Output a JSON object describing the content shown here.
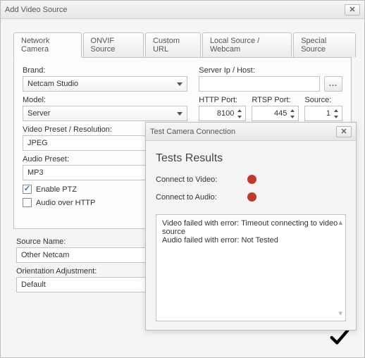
{
  "dialog": {
    "title": "Add Video Source",
    "tabs": [
      {
        "label": "Network Camera"
      },
      {
        "label": "ONVIF Source"
      },
      {
        "label": "Custom URL"
      },
      {
        "label": "Local Source / Webcam"
      },
      {
        "label": "Special Source"
      }
    ],
    "active_tab_index": 0
  },
  "form": {
    "brand_label": "Brand:",
    "brand_value": "Netcam Studio",
    "server_label": "Server Ip / Host:",
    "server_value": "",
    "browse_label": "...",
    "model_label": "Model:",
    "model_value": "Server",
    "http_port_label": "HTTP Port:",
    "http_port_value": "8100",
    "rtsp_port_label": "RTSP Port:",
    "rtsp_port_value": "445",
    "source_label": "Source:",
    "source_value": "1",
    "preset_label": "Video Preset / Resolution:",
    "preset_value": "JPEG",
    "audio_preset_label": "Audio Preset:",
    "audio_preset_value": "MP3",
    "enable_ptz_label": "Enable PTZ",
    "enable_ptz_checked": true,
    "audio_over_http_label": "Audio over HTTP",
    "audio_over_http_checked": false
  },
  "below": {
    "source_name_label": "Source Name:",
    "source_name_value": "Other Netcam",
    "orientation_label": "Orientation Adjustment:",
    "orientation_value": "Default"
  },
  "test": {
    "title": "Test Camera Connection",
    "results_header": "Tests Results",
    "video_label": "Connect to Video:",
    "audio_label": "Connect to Audio:",
    "video_status_color": "#c0392b",
    "audio_status_color": "#c0392b",
    "log_line1": "Video failed with error: Timeout connecting to video source",
    "log_line2": "Audio failed with error: Not Tested"
  }
}
